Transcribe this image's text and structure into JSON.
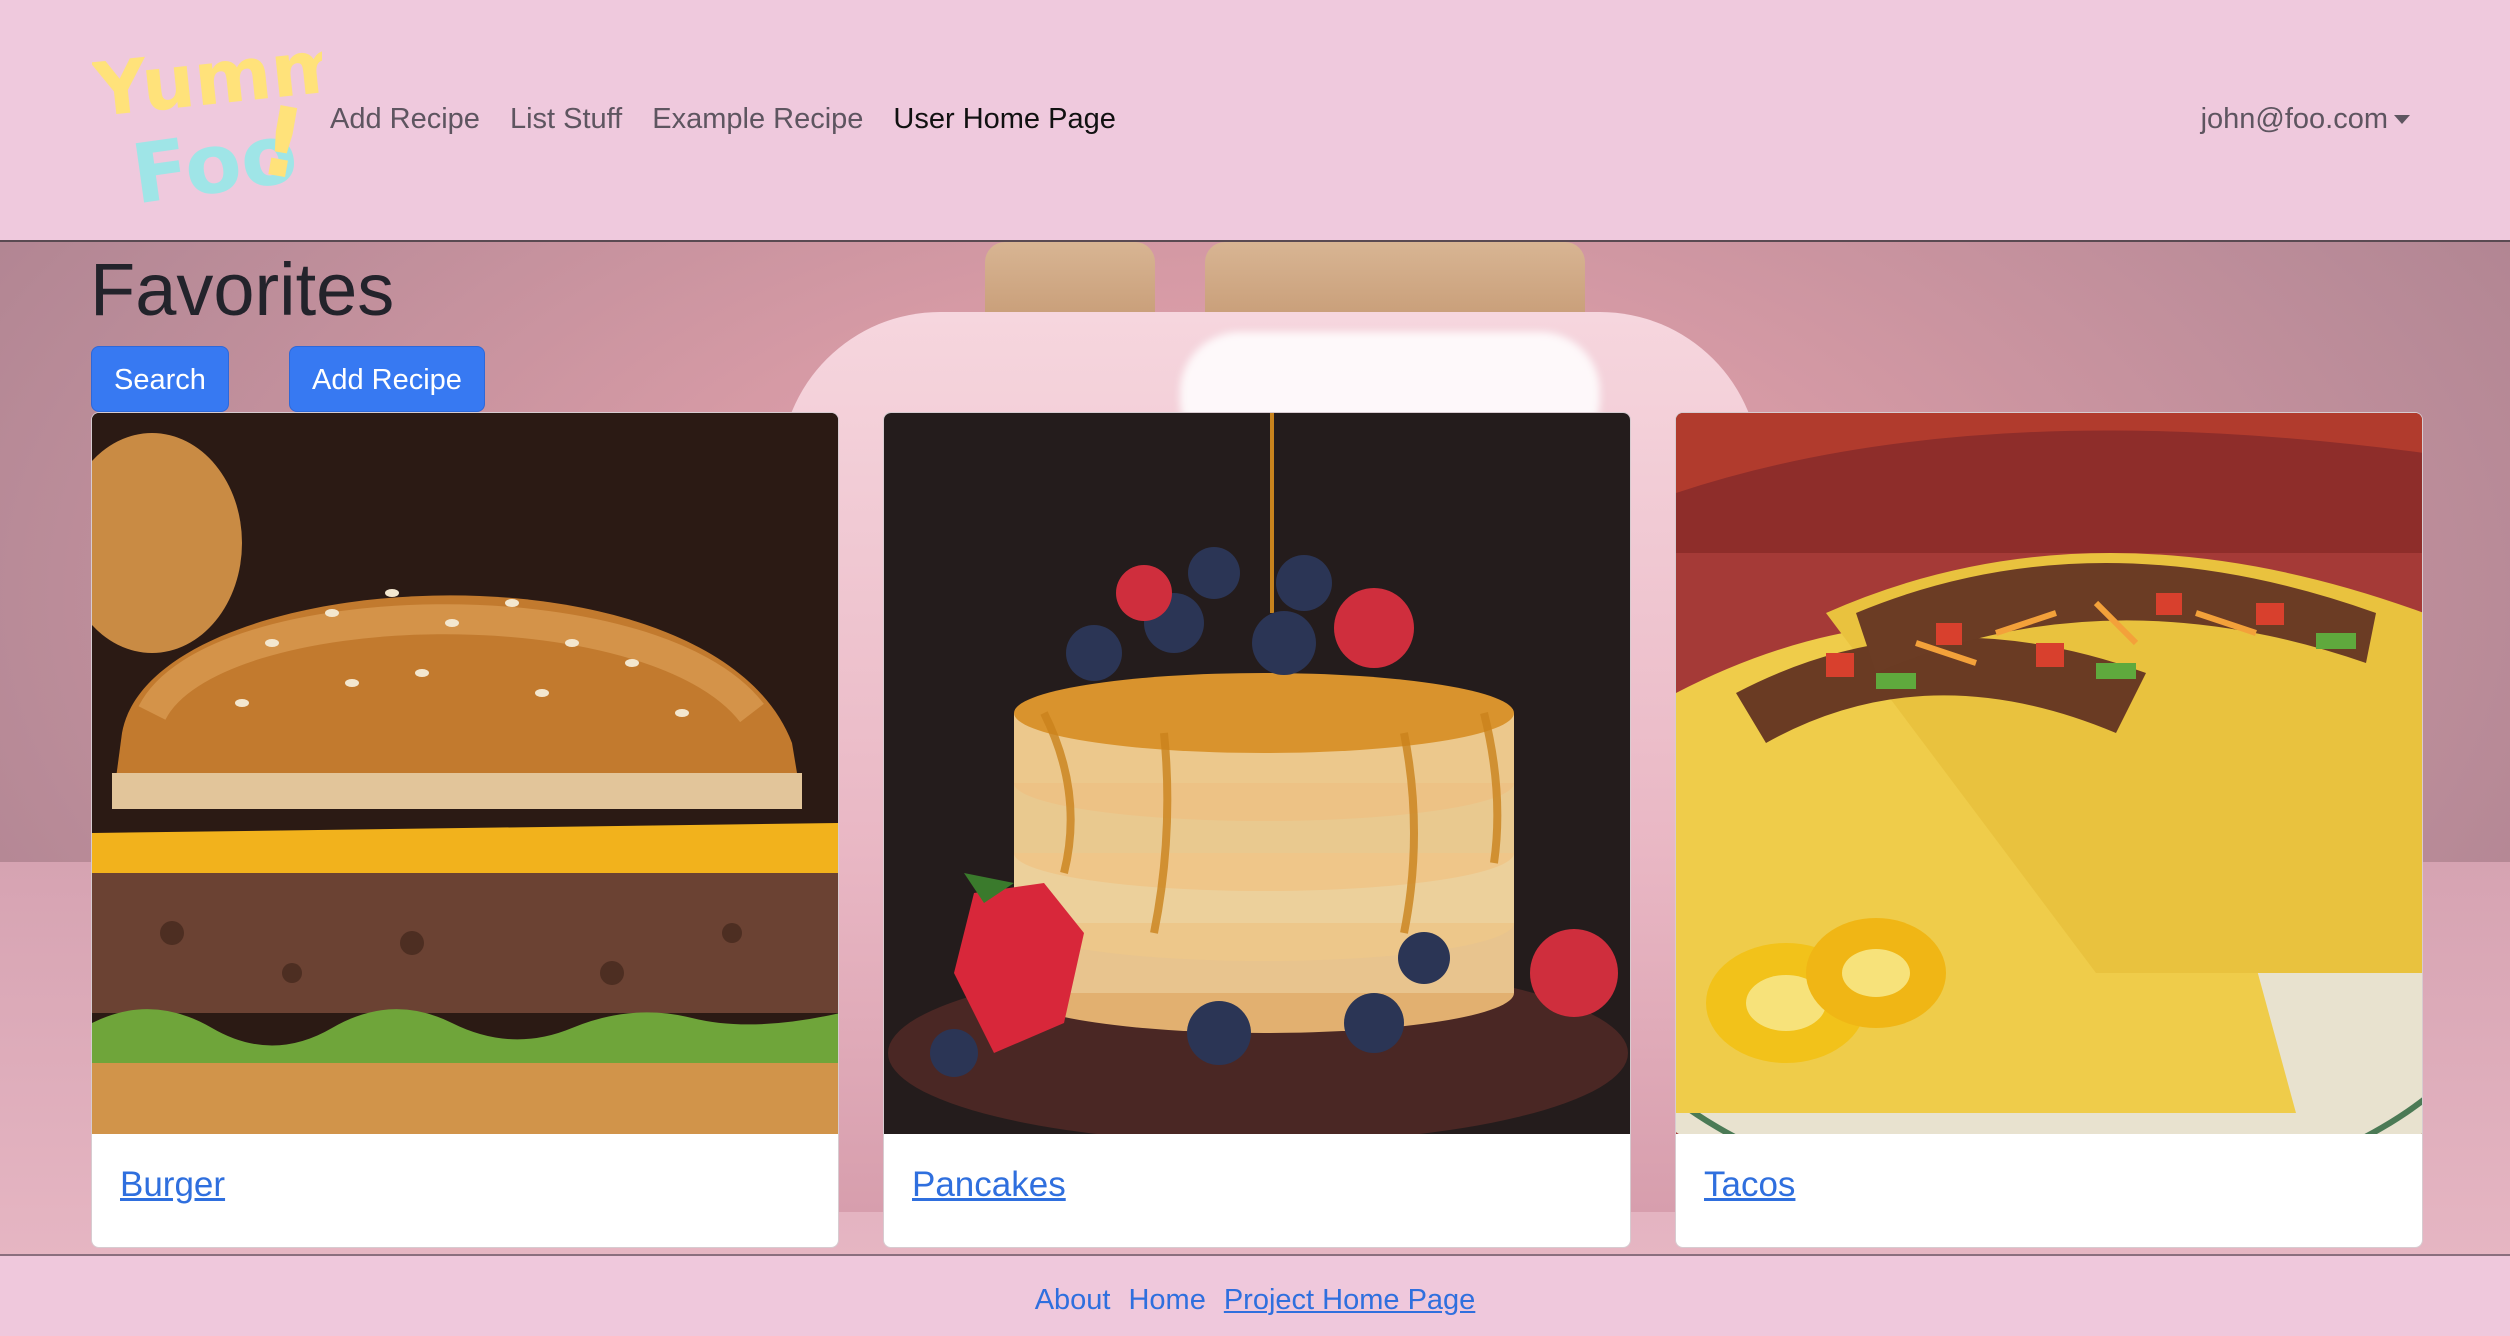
{
  "logo": {
    "text_line1": "Yummy",
    "text_line2": "Foo!",
    "colors": {
      "yellow": "#ffe27a",
      "cyan": "#9fe5e7"
    }
  },
  "nav": {
    "links": [
      "Add Recipe",
      "List Stuff",
      "Example Recipe",
      "User Home Page"
    ],
    "active": "User Home Page",
    "user": "john@foo.com"
  },
  "page": {
    "title": "Favorites"
  },
  "buttons": {
    "search": "Search",
    "add_recipe": "Add Recipe"
  },
  "cards": [
    {
      "title": "Burger",
      "image": "burger"
    },
    {
      "title": "Pancakes",
      "image": "pancakes"
    },
    {
      "title": "Tacos",
      "image": "tacos"
    }
  ],
  "footer": {
    "links": [
      "About",
      "Home",
      "Project Home Page"
    ]
  },
  "colors": {
    "navbar_bg": "#efc9dd",
    "primary": "#3779f2",
    "link": "#2f6fde"
  }
}
